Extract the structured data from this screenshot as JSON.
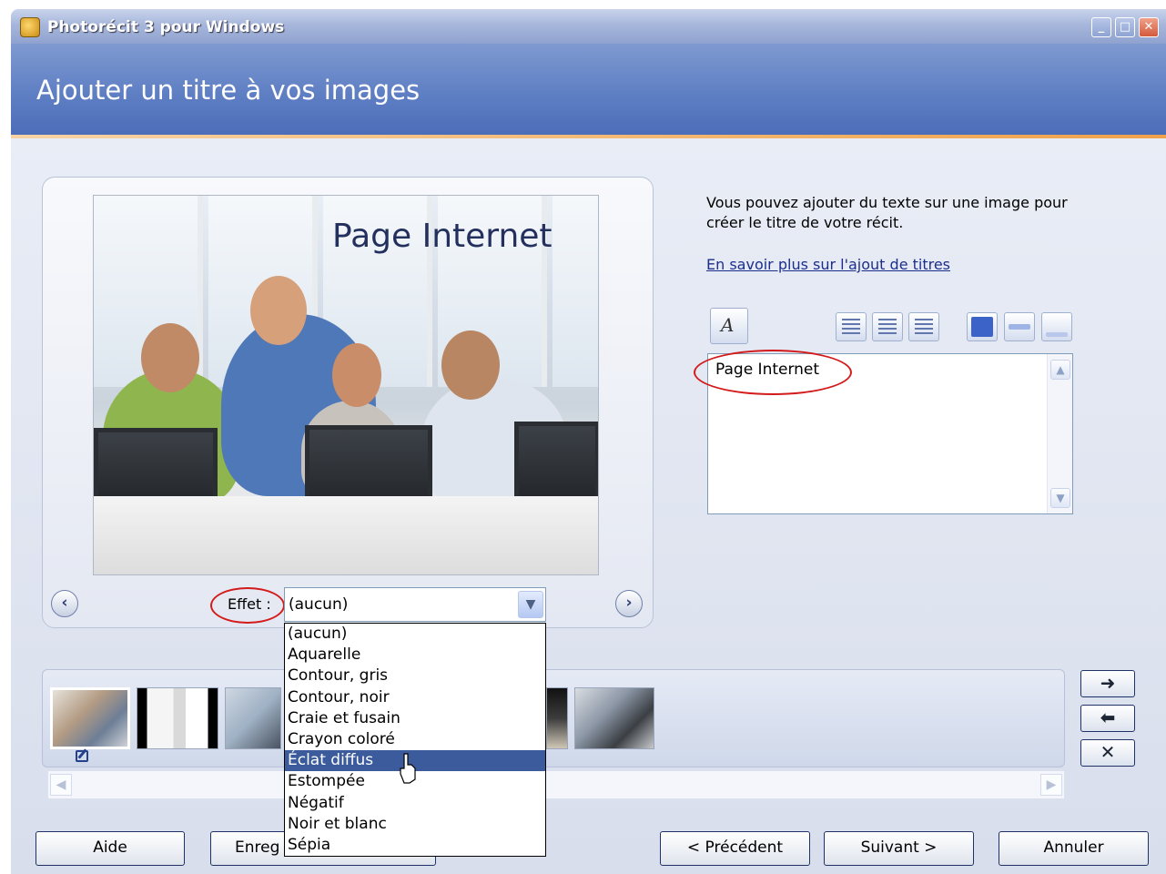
{
  "window": {
    "title": "Photorécit 3 pour Windows",
    "controls": [
      "_",
      "□",
      "✕"
    ]
  },
  "header": {
    "heading": "Ajouter un titre à vos images"
  },
  "preview": {
    "image_title": "Page Internet",
    "prev_glyph": "‹",
    "next_glyph": "›",
    "effect_label": "Effet :",
    "effect_value": "(aucun)",
    "effect_options": [
      "(aucun)",
      "Aquarelle",
      "Contour, gris",
      "Contour, noir",
      "Craie et fusain",
      "Crayon coloré",
      "Éclat diffus",
      "Estompée",
      "Négatif",
      "Noir et blanc",
      "Sépia"
    ],
    "effect_highlighted": "Éclat diffus"
  },
  "title_panel": {
    "description": "Vous pouvez ajouter du texte sur une image pour créer le titre de votre récit.",
    "learn_more_link": "En savoir plus sur l'ajout de titres",
    "text_value": "Page Internet",
    "font_glyph": "A"
  },
  "filmstrip": {
    "side_buttons": [
      "➜",
      "⬅",
      "✕"
    ]
  },
  "buttons": {
    "help": "Aide",
    "save": "Enreg",
    "previous": "< Précédent",
    "next": "Suivant >",
    "cancel": "Annuler"
  },
  "colors": {
    "header_blue": "#5f7fc4",
    "selection": "#3b5b9c",
    "annotation_red": "#d31b1b",
    "accent_orange": "#f0a24a"
  }
}
